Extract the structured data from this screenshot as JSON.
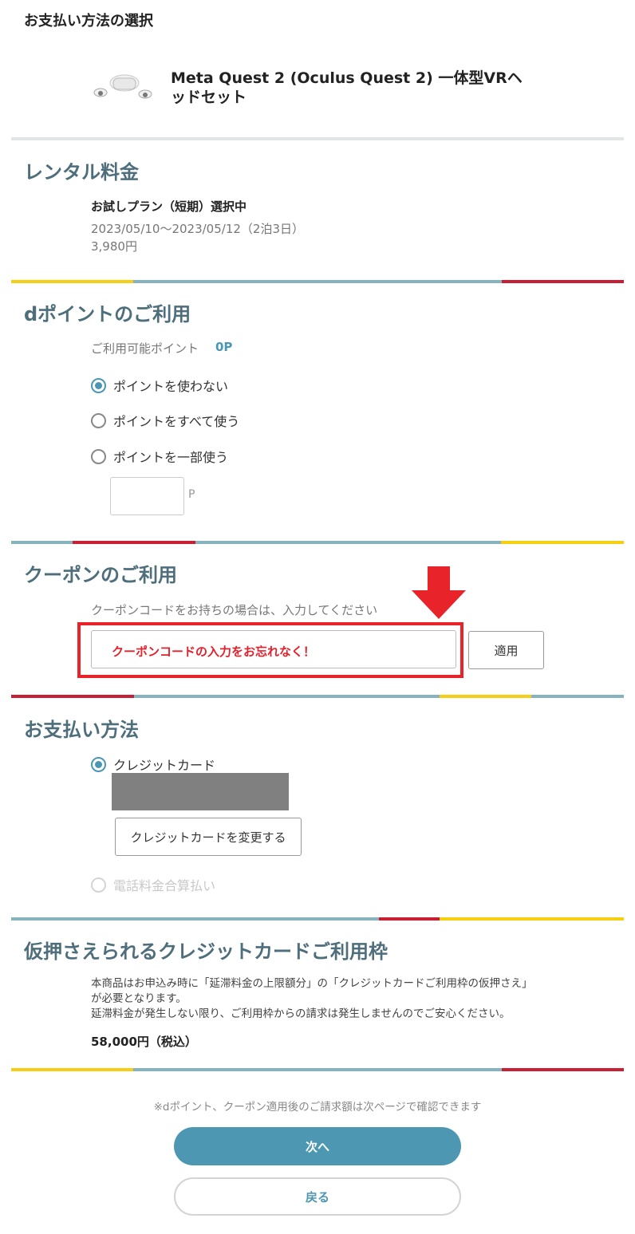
{
  "page_title": "お支払い方法の選択",
  "product": {
    "name": "Meta Quest 2 (Oculus Quest 2) 一体型VRヘッドセット",
    "image_icon": "vr-headset-icon"
  },
  "rental": {
    "title": "レンタル料金",
    "plan": "お試しプラン（短期）選択中",
    "period": "2023/05/10〜2023/05/12（2泊3日）",
    "price": "3,980円"
  },
  "dpoint": {
    "title": "dポイントのご利用",
    "available_label": "ご利用可能ポイント",
    "available_value": "0P",
    "options": [
      {
        "label": "ポイントを使わない",
        "selected": true
      },
      {
        "label": "ポイントをすべて使う",
        "selected": false
      },
      {
        "label": "ポイントを一部使う",
        "selected": false
      }
    ],
    "input_value": "",
    "unit": "P"
  },
  "coupon": {
    "title": "クーポンのご利用",
    "hint": "クーポンコードをお持ちの場合は、入力してください",
    "input_note": "クーポンコードの入力をお忘れなく！",
    "apply_label": "適用"
  },
  "payment": {
    "title": "お支払い方法",
    "options": [
      {
        "label": "クレジットカード",
        "selected": true,
        "disabled": false
      },
      {
        "label": "電話料金合算払い",
        "selected": false,
        "disabled": true
      }
    ],
    "change_card_label": "クレジットカードを変更する"
  },
  "credit_hold": {
    "title": "仮押さえられるクレジットカードご利用枠",
    "notice_line1": "本商品はお申込み時に「延滞料金の上限額分」の「クレジットカードご利用枠の仮押さえ」が必要となります。",
    "notice_line2": "延滞料金が発生しない限り、ご利用枠からの請求は発生しませんのでご安心ください。",
    "amount": "58,000円（税込）"
  },
  "footer": {
    "note": "※dポイント、クーポン適用後のご請求額は次ページで確認できます",
    "next_label": "次へ",
    "back_label": "戻る"
  },
  "colors": {
    "accent": "#4d97b2",
    "section_title": "#4e6e7b",
    "stripe_yellow": "#f6cf14",
    "stripe_blue": "#87b2bf",
    "stripe_red": "#c81f35",
    "highlight_red": "#e8232a"
  }
}
